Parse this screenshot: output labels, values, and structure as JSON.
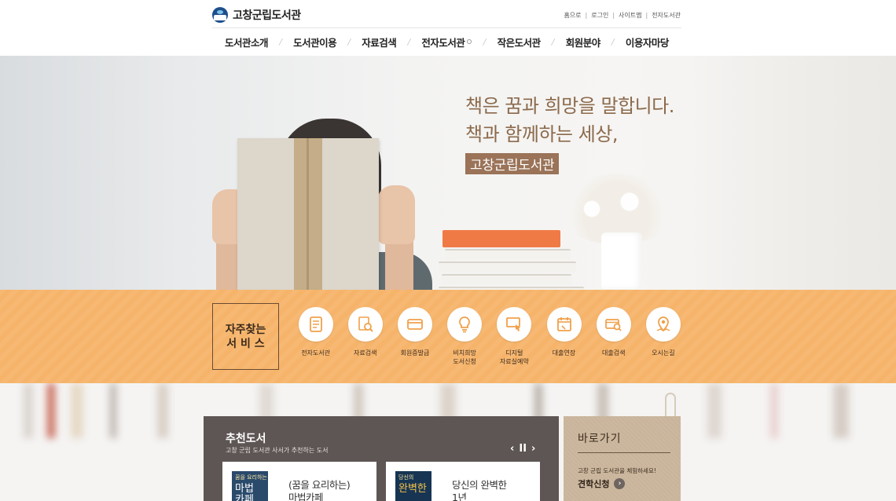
{
  "header": {
    "logo_text": "고창군립도서관",
    "util_links": [
      "홈으로",
      "로그인",
      "사이트맵",
      "전자도서관"
    ],
    "gnb": [
      "도서관소개",
      "도서관이용",
      "자료검색",
      "전자도서관",
      "작은도서관",
      "회원분야",
      "이용자마당"
    ]
  },
  "hero": {
    "line1": "책은 꿈과 희망을 말합니다.",
    "line2": "책과 함께하는 세상,",
    "tag": "고창군립도서관"
  },
  "services": {
    "title_line1": "자주찾는",
    "title_line2": "서 비 스",
    "items": [
      {
        "label": "전자도서관",
        "icon": "ebook-icon"
      },
      {
        "label": "자료검색",
        "icon": "search-book-icon"
      },
      {
        "label": "회원증발급",
        "icon": "card-icon"
      },
      {
        "label": "비치희망\n도서신청",
        "icon": "lightbulb-icon"
      },
      {
        "label": "디지털\n자료실예약",
        "icon": "monitor-hand-icon"
      },
      {
        "label": "대출연장",
        "icon": "calendar-icon"
      },
      {
        "label": "대출검색",
        "icon": "card-search-icon"
      },
      {
        "label": "오시는길",
        "icon": "map-pin-icon"
      }
    ]
  },
  "recommend": {
    "title": "추천도서",
    "subtitle": "고창 군립 도서관 사서가 추천하는 도서",
    "prev": "‹",
    "pause": "II",
    "next": "›",
    "books": [
      {
        "title_line1": "(꿈을 요리하는)",
        "title_line2": "마법카페",
        "cover_top": "꿈을 요리하는",
        "cover_main": "마법\n카페"
      },
      {
        "title_line1": "당신의 완벽한",
        "title_line2": "1년",
        "cover_top": "당신의",
        "cover_main": "완벽한"
      }
    ]
  },
  "shortcut": {
    "title": "바로가기",
    "subtitle": "고창 군립 도서관을 체험하세요!",
    "button": "견학신청",
    "arrow": "›"
  },
  "colors": {
    "accent": "#f6b46a",
    "brown": "#8c6a4c",
    "rec_bg": "#5e5654",
    "service_icon": "#f0a04b"
  }
}
